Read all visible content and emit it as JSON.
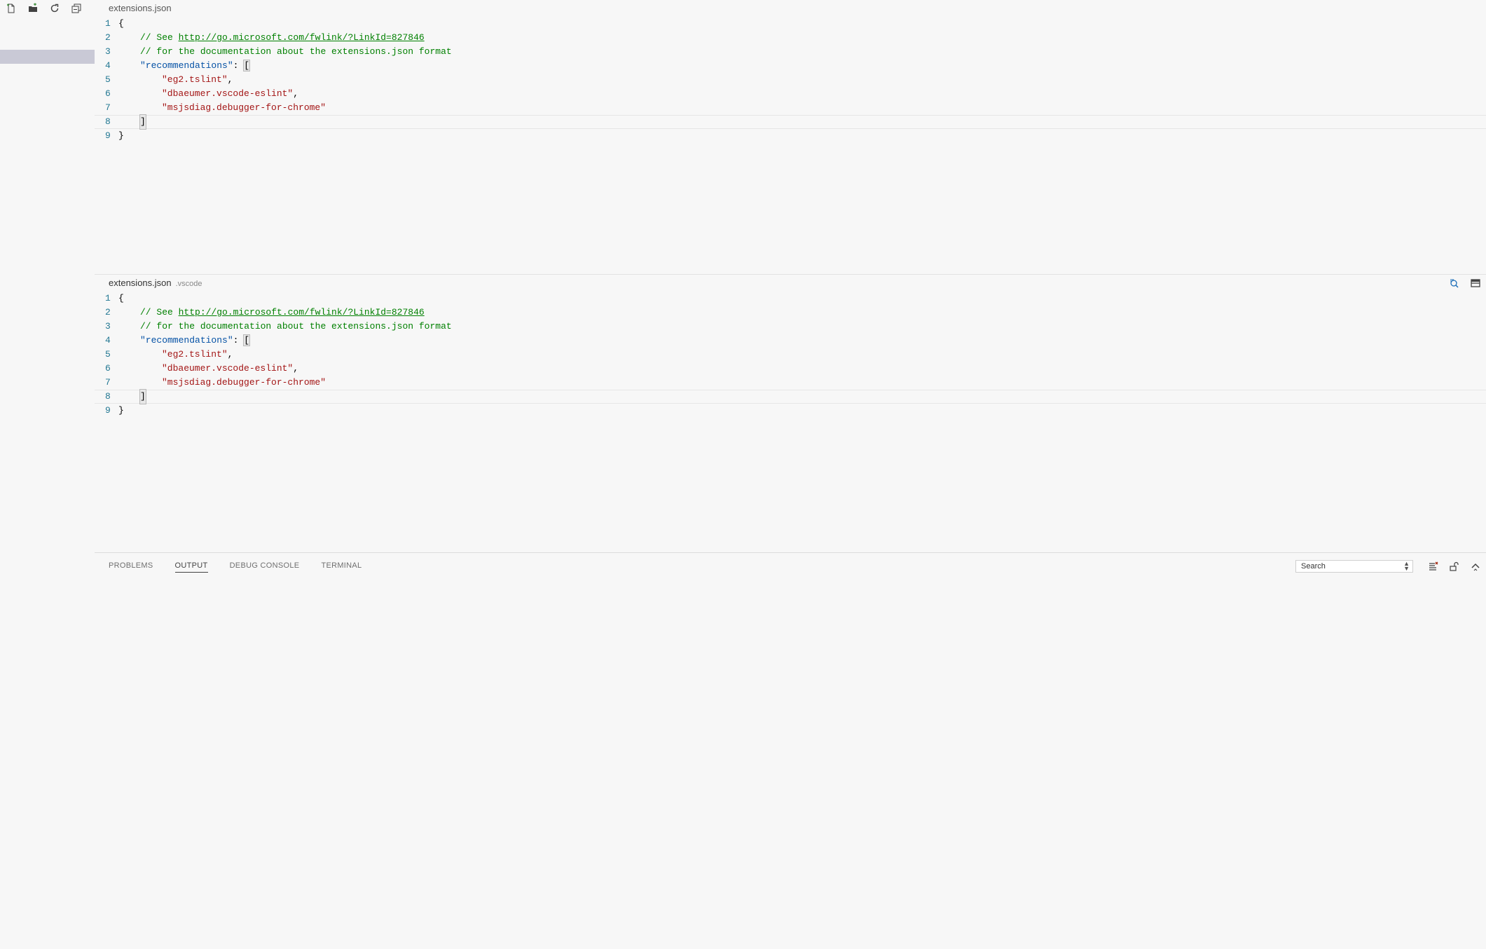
{
  "sidebar": {
    "toolbar": [
      {
        "name": "new-file-icon",
        "title": "New File"
      },
      {
        "name": "new-folder-icon",
        "title": "New Folder"
      },
      {
        "name": "refresh-icon",
        "title": "Refresh"
      },
      {
        "name": "collapse-all-icon",
        "title": "Collapse All"
      }
    ]
  },
  "editor_top": {
    "title": "extensions.json",
    "description": "",
    "lines": [
      {
        "num": "1",
        "open": "{"
      },
      {
        "num": "2",
        "comment": "// See ",
        "link": "http://go.microsoft.com/fwlink/?LinkId=827846"
      },
      {
        "num": "3",
        "comment": "// for the documentation about the extensions.json format"
      },
      {
        "num": "4",
        "key": "\"recommendations\"",
        "colon": ": ",
        "bracket": "["
      },
      {
        "num": "5",
        "value": "\"eg2.tslint\"",
        "comma": ","
      },
      {
        "num": "6",
        "value": "\"dbaeumer.vscode-eslint\"",
        "comma": ","
      },
      {
        "num": "7",
        "value": "\"msjsdiag.debugger-for-chrome\""
      },
      {
        "num": "8",
        "close_bracket": "]"
      },
      {
        "num": "9",
        "close": "}"
      }
    ]
  },
  "editor_bottom": {
    "title": "extensions.json",
    "description": ".vscode",
    "actions": [
      {
        "name": "open-changes-icon"
      },
      {
        "name": "split-editor-icon"
      }
    ],
    "lines": [
      {
        "num": "1",
        "open": "{"
      },
      {
        "num": "2",
        "comment": "// See ",
        "link": "http://go.microsoft.com/fwlink/?LinkId=827846"
      },
      {
        "num": "3",
        "comment": "// for the documentation about the extensions.json format"
      },
      {
        "num": "4",
        "key": "\"recommendations\"",
        "colon": ": ",
        "bracket": "["
      },
      {
        "num": "5",
        "value": "\"eg2.tslint\"",
        "comma": ","
      },
      {
        "num": "6",
        "value": "\"dbaeumer.vscode-eslint\"",
        "comma": ","
      },
      {
        "num": "7",
        "value": "\"msjsdiag.debugger-for-chrome\""
      },
      {
        "num": "8",
        "close_bracket": "]"
      },
      {
        "num": "9",
        "close": "}"
      }
    ]
  },
  "panel": {
    "tabs": [
      {
        "label": "PROBLEMS",
        "active": false
      },
      {
        "label": "OUTPUT",
        "active": true
      },
      {
        "label": "DEBUG CONSOLE",
        "active": false
      },
      {
        "label": "TERMINAL",
        "active": false
      }
    ],
    "output_channel": "Search",
    "actions": [
      {
        "name": "clear-output-icon"
      },
      {
        "name": "lock-scroll-icon"
      },
      {
        "name": "maximize-panel-icon"
      }
    ]
  },
  "colors": {
    "line_number": "#237893",
    "comment": "#008000",
    "json_key": "#0451a5",
    "string": "#a31515",
    "selection": "#c9c9d6"
  }
}
